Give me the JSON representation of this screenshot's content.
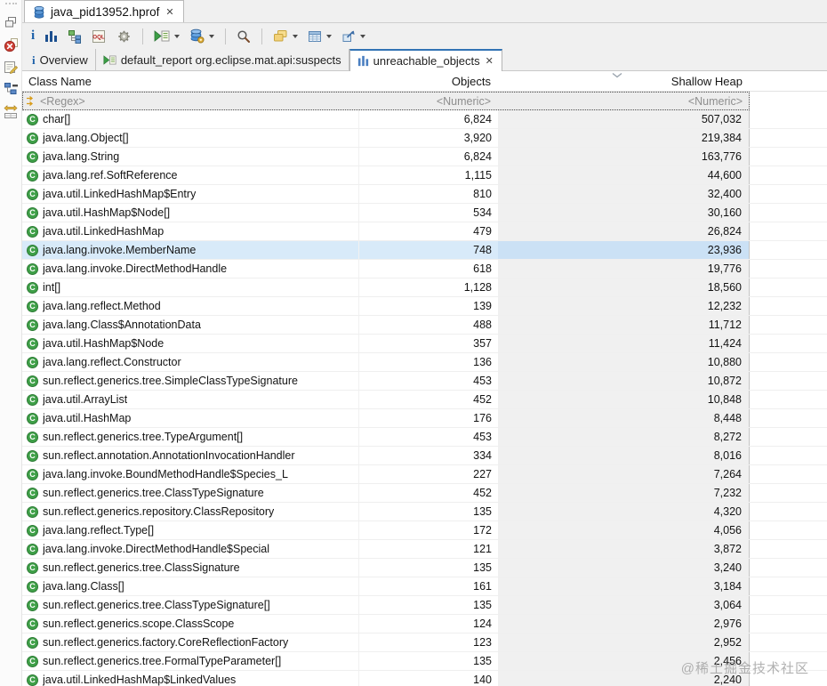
{
  "window": {
    "editor_tab": {
      "label": "java_pid13952.hprof",
      "icon": "heap-dump-database-icon"
    }
  },
  "icons": {
    "close": "✕",
    "class_letter": "C"
  },
  "toolbar": {
    "oql_label": "OQL",
    "buttons": [
      "overview-info",
      "histogram",
      "dominator-tree",
      "oql",
      "thread-overview",
      "run-expert-report",
      "open-query-browser",
      "search",
      "group-result",
      "calculate-retained-size",
      "export"
    ]
  },
  "view_tabs": [
    {
      "label": "Overview",
      "icon": "info-icon",
      "active": false
    },
    {
      "label": "default_report org.eclipse.mat.api:suspects",
      "icon": "report-icon",
      "active": false
    },
    {
      "label": "unreachable_objects",
      "icon": "histogram-icon",
      "active": true,
      "closable": true
    }
  ],
  "table": {
    "columns": [
      {
        "label": "Class Name",
        "align": "left"
      },
      {
        "label": "Objects",
        "align": "right"
      },
      {
        "label": "Shallow Heap",
        "align": "right",
        "sorted": "desc"
      }
    ],
    "filter_row": {
      "class_name": "<Regex>",
      "objects": "<Numeric>",
      "shallow_heap": "<Numeric>"
    },
    "selected_index": 7,
    "rows": [
      [
        "char[]",
        "6,824",
        "507,032"
      ],
      [
        "java.lang.Object[]",
        "3,920",
        "219,384"
      ],
      [
        "java.lang.String",
        "6,824",
        "163,776"
      ],
      [
        "java.lang.ref.SoftReference",
        "1,115",
        "44,600"
      ],
      [
        "java.util.LinkedHashMap$Entry",
        "810",
        "32,400"
      ],
      [
        "java.util.HashMap$Node[]",
        "534",
        "30,160"
      ],
      [
        "java.util.LinkedHashMap",
        "479",
        "26,824"
      ],
      [
        "java.lang.invoke.MemberName",
        "748",
        "23,936"
      ],
      [
        "java.lang.invoke.DirectMethodHandle",
        "618",
        "19,776"
      ],
      [
        "int[]",
        "1,128",
        "18,560"
      ],
      [
        "java.lang.reflect.Method",
        "139",
        "12,232"
      ],
      [
        "java.lang.Class$AnnotationData",
        "488",
        "11,712"
      ],
      [
        "java.util.HashMap$Node",
        "357",
        "11,424"
      ],
      [
        "java.lang.reflect.Constructor",
        "136",
        "10,880"
      ],
      [
        "sun.reflect.generics.tree.SimpleClassTypeSignature",
        "453",
        "10,872"
      ],
      [
        "java.util.ArrayList",
        "452",
        "10,848"
      ],
      [
        "java.util.HashMap",
        "176",
        "8,448"
      ],
      [
        "sun.reflect.generics.tree.TypeArgument[]",
        "453",
        "8,272"
      ],
      [
        "sun.reflect.annotation.AnnotationInvocationHandler",
        "334",
        "8,016"
      ],
      [
        "java.lang.invoke.BoundMethodHandle$Species_L",
        "227",
        "7,264"
      ],
      [
        "sun.reflect.generics.tree.ClassTypeSignature",
        "452",
        "7,232"
      ],
      [
        "sun.reflect.generics.repository.ClassRepository",
        "135",
        "4,320"
      ],
      [
        "java.lang.reflect.Type[]",
        "172",
        "4,056"
      ],
      [
        "java.lang.invoke.DirectMethodHandle$Special",
        "121",
        "3,872"
      ],
      [
        "sun.reflect.generics.tree.ClassSignature",
        "135",
        "3,240"
      ],
      [
        "java.lang.Class[]",
        "161",
        "3,184"
      ],
      [
        "sun.reflect.generics.tree.ClassTypeSignature[]",
        "135",
        "3,064"
      ],
      [
        "sun.reflect.generics.scope.ClassScope",
        "124",
        "2,976"
      ],
      [
        "sun.reflect.generics.factory.CoreReflectionFactory",
        "123",
        "2,952"
      ],
      [
        "sun.reflect.generics.tree.FormalTypeParameter[]",
        "135",
        "2,456"
      ],
      [
        "java.util.LinkedHashMap$LinkedValues",
        "140",
        "2,240"
      ]
    ]
  },
  "watermark": "@稀土掘金技术社区",
  "colors": {
    "selection": "#d8eaf9",
    "selection_shallow": "#cbe1f5",
    "shallow_column_bg": "#f0f0f0",
    "active_tab_accent": "#3173b4",
    "class_icon_green": "#3fa048",
    "toolbar_bg": "#f0f0f0"
  }
}
